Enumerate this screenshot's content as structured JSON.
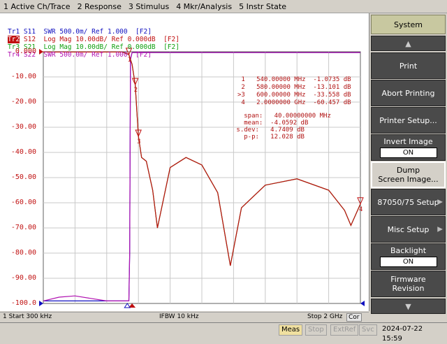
{
  "menu": [
    "1 Active Ch/Trace",
    "2 Response",
    "3 Stimulus",
    "4 Mkr/Analysis",
    "5 Instr State"
  ],
  "traces": [
    {
      "id": "Tr1",
      "text": " S11  SWR 500.0m/ Ref 1.000  [F2]",
      "color": "#1010c0",
      "active": false
    },
    {
      "id": "Tr2",
      "text": " S12  Log Mag 10.00dB/ Ref 0.000dB  [F2]",
      "color": "#c01010",
      "active": true
    },
    {
      "id": "Tr3",
      "text": " S21  Log Mag 10.00dB/ Ref 0.000dB  [F2]",
      "color": "#10a010",
      "active": false
    },
    {
      "id": "Tr4",
      "text": " S22  SWR 500.0m/ Ref 1.000  [F2]",
      "color": "#b010b0",
      "active": false
    }
  ],
  "y_labels": [
    "0.000",
    "-10.00",
    "-20.00",
    "-30.00",
    "-40.00",
    "-50.00",
    "-60.00",
    "-70.00",
    "-80.00",
    "-90.00",
    "-100.0"
  ],
  "markers": [
    " 1   540.00000 MHz  -1.0735 dB",
    " 2   580.00000 MHz  -13.101 dB",
    ">3   600.00000 MHz  -33.558 dB",
    " 4   2.0000000 GHz  -60.457 dB"
  ],
  "stats": [
    "   span:   40.00000000 MHz",
    "   mean:  -4.0592 dB",
    " s.dev:   4.7409 dB",
    "   p-p:   12.028 dB"
  ],
  "bottom": {
    "start": "1  Start 300 kHz",
    "ifbw": "IFBW 10 kHz",
    "stop": "Stop 2 GHz",
    "cor": "Cor"
  },
  "status": {
    "meas": "Meas",
    "stop": "Stop",
    "extref": "ExtRef",
    "svc": "Svc",
    "time": "2024-07-22 15:59"
  },
  "softkeys": {
    "title": "System",
    "print": "Print",
    "abort": "Abort Printing",
    "printer_setup": "Printer Setup...",
    "invert_image": "Invert Image",
    "invert_value": "ON",
    "dump_line1": "Dump",
    "dump_line2": "Screen Image...",
    "setup": "87050/75 Setup",
    "misc": "Misc Setup",
    "backlight": "Backlight",
    "backlight_value": "ON",
    "firmware_line1": "Firmware",
    "firmware_line2": "Revision"
  },
  "chart_data": {
    "type": "line",
    "x_start": "300 kHz",
    "x_stop": "2 GHz",
    "ylim": [
      -100,
      0
    ],
    "grid": true,
    "series": [
      {
        "name": "S11",
        "color": "#1010c0",
        "x": [
          0.3,
          200,
          400,
          500,
          530,
          540,
          545,
          550,
          560,
          580,
          600,
          1000,
          1500,
          2000
        ],
        "y": [
          -99,
          -99,
          -99,
          -99,
          -99,
          -99,
          -80,
          -3,
          -0.3,
          -0.3,
          -0.3,
          -0.3,
          -0.3,
          -0.3
        ]
      },
      {
        "name": "S12",
        "color": "#c01010",
        "x": [
          0.3,
          100,
          300,
          500,
          540,
          560,
          580,
          600,
          620,
          650,
          690,
          720,
          800,
          900,
          1000,
          1100,
          1180,
          1250,
          1400,
          1600,
          1800,
          1900,
          1940,
          2000
        ],
        "y": [
          -0.1,
          -0.1,
          -0.1,
          -0.1,
          -1.1,
          -5,
          -13.1,
          -33.6,
          -42,
          -43.5,
          -55,
          -70,
          -46,
          -42,
          -45,
          -56,
          -85,
          -62,
          -53,
          -50.5,
          -55,
          -63,
          -69,
          -60.5
        ]
      },
      {
        "name": "S21",
        "color": "#10a010",
        "x": [
          0.3,
          100,
          300,
          500,
          540,
          560,
          580,
          600,
          620,
          650,
          690,
          720,
          800,
          900,
          1000,
          1100,
          1180,
          1250,
          1400,
          1600,
          1800,
          1900,
          1940,
          2000
        ],
        "y": [
          -0.1,
          -0.1,
          -0.1,
          -0.1,
          -1.1,
          -5,
          -13.1,
          -33.6,
          -42,
          -43.5,
          -55,
          -70,
          -46,
          -42,
          -45,
          -56,
          -85,
          -62,
          -53,
          -50.5,
          -55,
          -63,
          -69,
          -60.5
        ]
      },
      {
        "name": "S22",
        "color": "#b010b0",
        "x": [
          0.3,
          100,
          200,
          300,
          400,
          500,
          530,
          540,
          545,
          550,
          560,
          600,
          1000,
          1500,
          2000
        ],
        "y": [
          -99,
          -97.5,
          -97,
          -98,
          -99,
          -99,
          -99,
          -99,
          -80,
          -3,
          -0.3,
          -0.3,
          -0.3,
          -0.3,
          -0.3
        ]
      }
    ]
  }
}
